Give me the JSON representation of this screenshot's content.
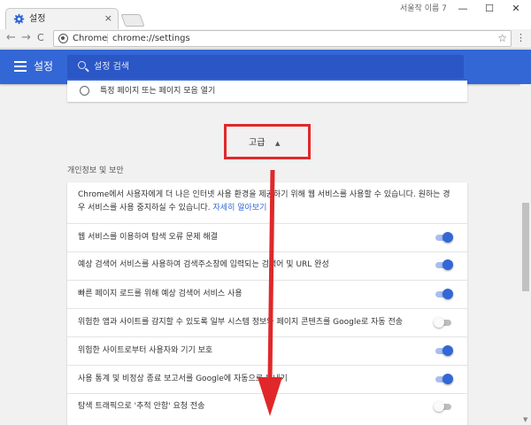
{
  "tab": {
    "title": "설정",
    "close": "×"
  },
  "window": {
    "user": "서울작 이름 7",
    "minimize": "—",
    "maximize": "☐",
    "close": "✕"
  },
  "toolbar": {
    "back": "←",
    "forward": "→",
    "reload": "C",
    "omni_origin": "Chrome",
    "omni_url": "chrome://settings",
    "star": "☆",
    "menu": "⋮"
  },
  "header": {
    "title": "설정",
    "search_placeholder": "설정 검색",
    "color": "#3367d6"
  },
  "startup": {
    "option": "특정 페이지 또는 페이지 모음 열기"
  },
  "advanced": {
    "label": "고급",
    "arrow": "▲",
    "highlight_color": "#e0282b"
  },
  "privacy": {
    "section_title": "개인정보 및 보안",
    "intro_line1": "Chrome에서 사용자에게 더 나은 인터넷 사용 환경을 제공하기 위해 웹 서비스를 사용할 수 있습니다. 원하는 경",
    "intro_line2": "우 서비스를 사용 중지하실 수 있습니다.",
    "learn_more": "자세히 알아보기",
    "rows": [
      {
        "label": "웹 서비스를 이용하여 탐색 오류 문제 해결",
        "on": true
      },
      {
        "label": "예상 검색어 서비스를 사용하여 검색주소창에 입력되는 검색어 및 URL 완성",
        "on": true
      },
      {
        "label": "빠른 페이지 로드를 위해 예상 검색어 서비스 사용",
        "on": true
      },
      {
        "label": "위험한 앱과 사이트를 감지할 수 있도록 일부 시스템 정보와 페이지 콘텐츠를 Google로 자동 전송",
        "on": false
      },
      {
        "label": "위험한 사이트로부터 사용자와 기기 보호",
        "on": true
      },
      {
        "label": "사용 통계 및 비정상 종료 보고서를 Google에 자동으로 보내기",
        "on": true
      },
      {
        "label": "탐색 트래픽으로 '추적 안함' 요청 전송",
        "on": false
      }
    ]
  }
}
